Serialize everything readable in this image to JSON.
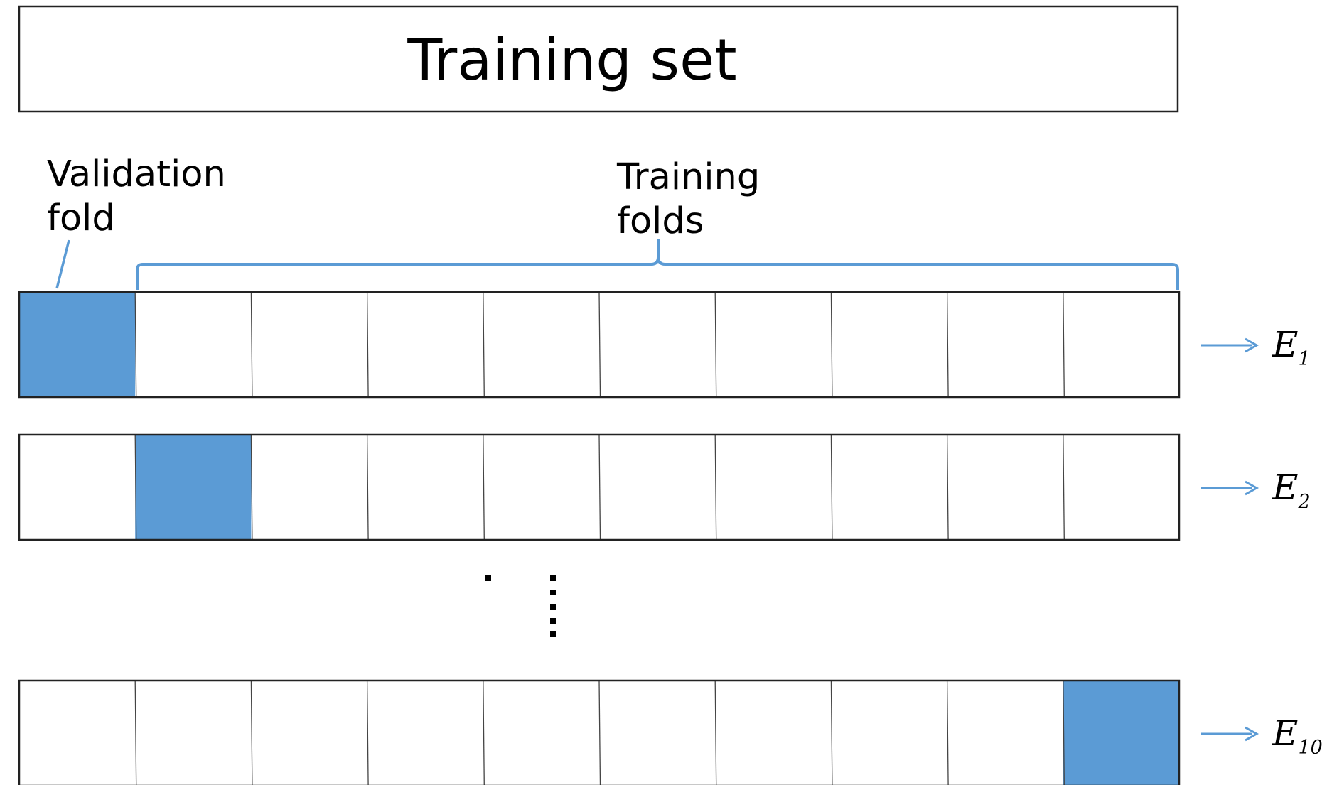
{
  "title": "Training set",
  "labels": {
    "validation_line1": "Validation",
    "validation_line2": "fold",
    "training_line1": "Training",
    "training_line2": "folds"
  },
  "folds": [
    {
      "highlight_index": 0,
      "error_letter": "E",
      "error_sub": "1"
    },
    {
      "highlight_index": 1,
      "error_letter": "E",
      "error_sub": "2"
    },
    {
      "highlight_index": 9,
      "error_letter": "E",
      "error_sub": "10"
    }
  ],
  "fold_count": 10,
  "colors": {
    "highlight": "#5b9bd5",
    "accent": "#5b9bd5",
    "stroke": "#222222",
    "divider": "#444444"
  }
}
